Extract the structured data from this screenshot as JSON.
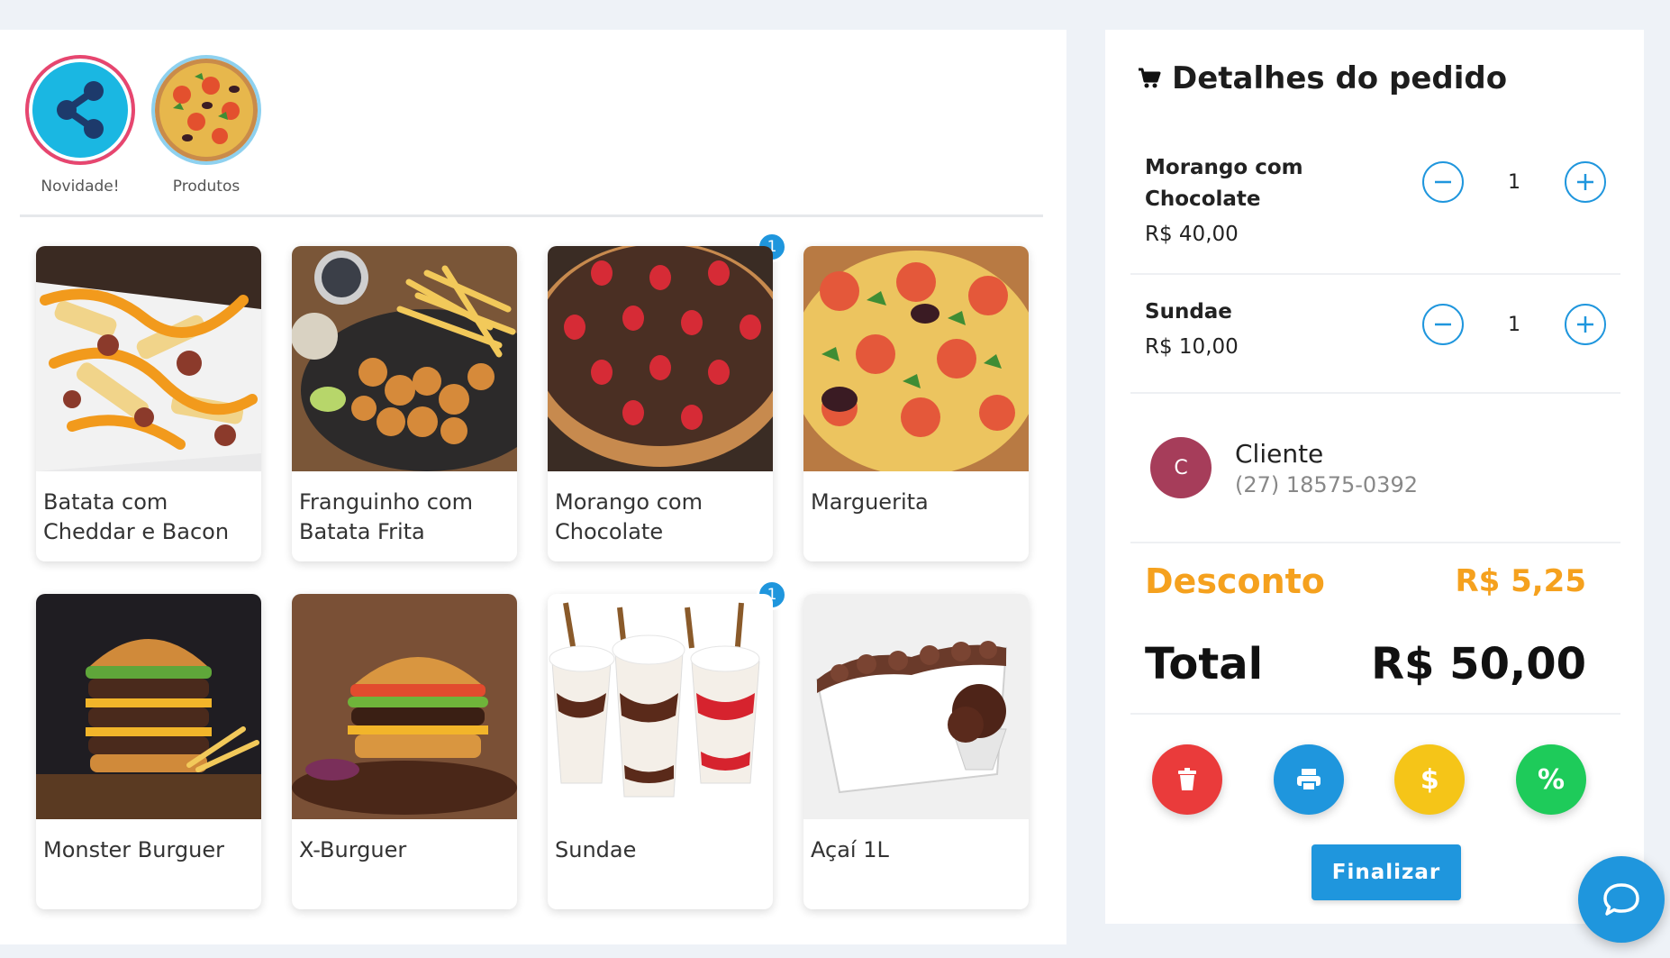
{
  "categories": [
    {
      "label": "Novidade!",
      "icon": "share-nodes-icon"
    },
    {
      "label": "Produtos",
      "icon": "pizza-icon"
    }
  ],
  "products": [
    {
      "name": "Batata com Cheddar e Bacon",
      "badge": null
    },
    {
      "name": "Franguinho com Batata Frita",
      "badge": null
    },
    {
      "name": "Morango com Chocolate",
      "badge": "1"
    },
    {
      "name": "Marguerita",
      "badge": null
    },
    {
      "name": "Monster Burguer",
      "badge": null
    },
    {
      "name": "X-Burguer",
      "badge": null
    },
    {
      "name": "Sundae",
      "badge": "1"
    },
    {
      "name": "Açaí 1L",
      "badge": null
    }
  ],
  "order": {
    "title": "Detalhes do pedido",
    "title_icon": "cart-icon",
    "items": [
      {
        "name": "Morango com Chocolate",
        "price": "R$ 40,00",
        "qty": "1"
      },
      {
        "name": "Sundae",
        "price": "R$ 10,00",
        "qty": "1"
      }
    ],
    "client": {
      "initial": "C",
      "name": "Cliente",
      "phone": "(27) 18575-0392"
    },
    "discount_label": "Desconto",
    "discount_value": "R$ 5,25",
    "total_label": "Total",
    "total_value": "R$ 50,00",
    "actions": [
      {
        "name": "delete",
        "icon": "trash-icon",
        "glyph": "",
        "color": "#ea3b3b"
      },
      {
        "name": "print",
        "icon": "printer-icon",
        "glyph": "",
        "color": "#1f96dd"
      },
      {
        "name": "payment",
        "icon": "dollar-icon",
        "glyph": "$",
        "color": "#f5c518"
      },
      {
        "name": "discount",
        "icon": "percent-icon",
        "glyph": "%",
        "color": "#1ecb5a"
      }
    ],
    "finalize_label": "Finalizar"
  },
  "colors": {
    "primary": "#1f96dd",
    "discount": "#f5a11e",
    "avatar": "#a63d5a",
    "novidade_ring": "#e7466f"
  }
}
